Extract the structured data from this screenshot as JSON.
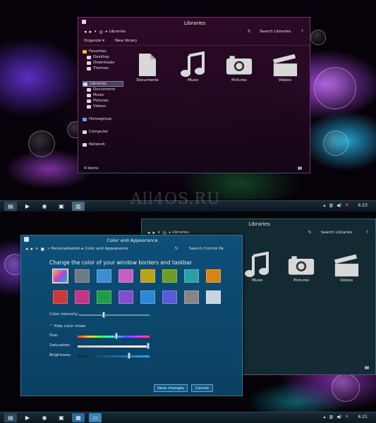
{
  "explorer_top": {
    "title": "Libraries",
    "breadcrumb_root": "Libraries",
    "search_placeholder": "Search Libraries",
    "help_label": "?",
    "organize_label": "Organize",
    "new_library_label": "New library",
    "status": "4 items",
    "sidebar": {
      "favorites": "Favorites",
      "favorites_items": [
        "Desktop",
        "Downloads",
        "Themes"
      ],
      "libraries": "Libraries",
      "libraries_items": [
        "Documents",
        "Music",
        "Pictures",
        "Videos"
      ],
      "homegroup": "Homegroup",
      "computer": "Computer",
      "network": "Network"
    },
    "libraries": [
      {
        "label": "Documents",
        "icon": "document-icon"
      },
      {
        "label": "Music",
        "icon": "music-note-icon"
      },
      {
        "label": "Pictures",
        "icon": "camera-icon"
      },
      {
        "label": "Videos",
        "icon": "clapperboard-icon"
      }
    ]
  },
  "taskbar_top": {
    "clock": "6:23"
  },
  "watermark": "All4OS.RU",
  "explorer_bottom": {
    "title": "Libraries",
    "breadcrumb_root": "Libraries",
    "search_placeholder": "Search Libraries",
    "libraries": [
      {
        "label": "Music",
        "icon": "music-note-icon"
      },
      {
        "label": "Pictures",
        "icon": "camera-icon"
      },
      {
        "label": "Videos",
        "icon": "clapperboard-icon"
      }
    ]
  },
  "color_panel": {
    "title": "Color and Appearance",
    "breadcrumb": [
      "Personalization",
      "Color and Appearance"
    ],
    "search_placeholder": "Search Control Pa",
    "heading": "Change the color of your window borders and taskbar",
    "swatches_row1": [
      "#6f6fd0",
      "#6b7a86",
      "#3b8fd0",
      "#c55fc4",
      "#b8a21e",
      "#6e9c2a",
      "#2b9ea8",
      "#d3851c"
    ],
    "swatches_row2": [
      "#c83a3a",
      "#c03586",
      "#1f9c4a",
      "#7f4fd0",
      "#2f86d6",
      "#5a5ad8",
      "#858585",
      "#c5d6de"
    ],
    "color_intensity_label": "Color intensity:",
    "color_intensity": 0.35,
    "hide_mixer_label": "Hide color mixer",
    "hue_label": "Hue:",
    "hue": 0.55,
    "saturation_label": "Saturation:",
    "saturation": 1.0,
    "brightness_label": "Brightness:",
    "brightness": 0.73,
    "save_label": "Save changes",
    "cancel_label": "Cancel"
  },
  "taskbar_bottom": {
    "clock": "6:21"
  }
}
